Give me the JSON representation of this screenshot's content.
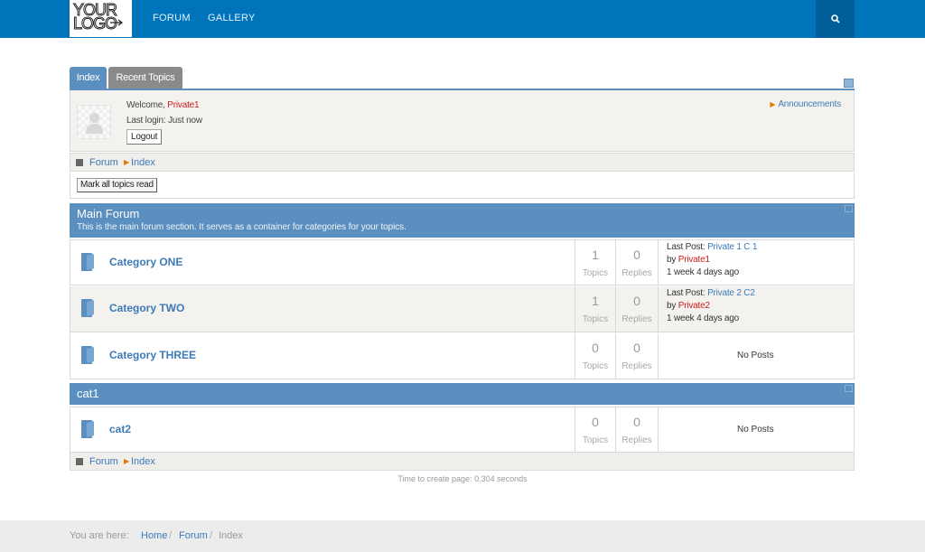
{
  "header": {
    "logo_line1": "YOUR",
    "logo_line2": "LOGO",
    "nav": [
      "FORUM",
      "GALLERY"
    ]
  },
  "tabs": [
    "Index",
    "Recent Topics"
  ],
  "welcome": {
    "greeting": "Welcome,",
    "username": "Private1",
    "last_login_label": "Last login:",
    "last_login_value": "Just now",
    "logout_label": "Logout",
    "announcements_label": "Announcements"
  },
  "breadcrumb": [
    "Forum",
    "Index"
  ],
  "mark_all_label": "Mark all topics read",
  "sections": [
    {
      "title": "Main Forum",
      "description": "This is the main forum section. It serves as a container for categories for your topics.",
      "categories": [
        {
          "name": "Category ONE",
          "topics": "1",
          "topics_label": "Topics",
          "replies": "0",
          "replies_label": "Replies",
          "last_post_label": "Last Post:",
          "last_post_topic": "Private 1 C 1",
          "by_label": "by",
          "last_post_user": "Private1",
          "last_post_time": "1 week 4 days ago"
        },
        {
          "name": "Category TWO",
          "topics": "1",
          "topics_label": "Topics",
          "replies": "0",
          "replies_label": "Replies",
          "last_post_label": "Last Post:",
          "last_post_topic": "Private 2 C2",
          "by_label": "by",
          "last_post_user": "Private2",
          "last_post_time": "1 week 4 days ago"
        },
        {
          "name": "Category THREE",
          "topics": "0",
          "topics_label": "Topics",
          "replies": "0",
          "replies_label": "Replies",
          "no_posts": "No Posts"
        }
      ]
    },
    {
      "title": "cat1",
      "categories": [
        {
          "name": "cat2",
          "topics": "0",
          "topics_label": "Topics",
          "replies": "0",
          "replies_label": "Replies",
          "no_posts": "No Posts"
        }
      ]
    }
  ],
  "page_timer": "Time to create page: 0.304 seconds",
  "footer": {
    "you_are_here": "You are here:",
    "crumbs": [
      "Home",
      "Forum",
      "Index"
    ],
    "separator": "/"
  },
  "colors": {
    "topbar": "#0074bb",
    "section_header": "#5a8fbf",
    "link": "#3c7ab8",
    "username": "#cc1d1d"
  }
}
